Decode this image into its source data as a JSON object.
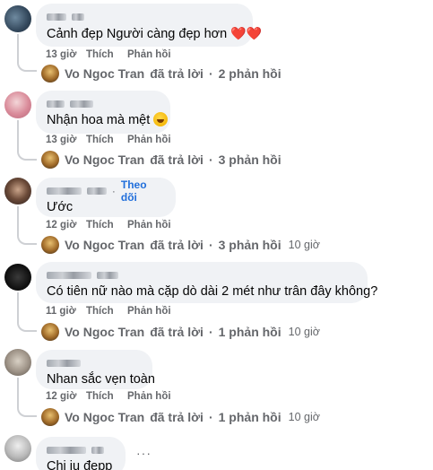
{
  "comments": [
    {
      "text": "Cảnh đẹp Người càng đẹp hơn",
      "emoji": "❤️❤️",
      "time": "13 giờ",
      "like": "Thích",
      "reply": "Phản hồi",
      "reply_summary": {
        "author": "Vo Ngoc Tran",
        "verb": "đã trả lời",
        "sep": "·",
        "count": "2 phản hồi",
        "time": ""
      }
    },
    {
      "text": "Nhận hoa mà mệt",
      "emoji": "laughing-face",
      "time": "13 giờ",
      "like": "Thích",
      "reply": "Phản hồi",
      "reply_summary": {
        "author": "Vo Ngoc Tran",
        "verb": "đã trả lời",
        "sep": "·",
        "count": "3 phản hồi",
        "time": ""
      }
    },
    {
      "text": "Ước",
      "follow": "Theo dõi",
      "follow_sep": "·",
      "time": "12 giờ",
      "like": "Thích",
      "reply": "Phản hồi",
      "reply_summary": {
        "author": "Vo Ngoc Tran",
        "verb": "đã trả lời",
        "sep": "·",
        "count": "3 phản hồi",
        "time": "10 giờ"
      }
    },
    {
      "text": "Có tiên nữ nào mà cặp dò dài 2 mét như trân đây không?",
      "time": "11 giờ",
      "like": "Thích",
      "reply": "Phản hồi",
      "reply_summary": {
        "author": "Vo Ngoc Tran",
        "verb": "đã trả lời",
        "sep": "·",
        "count": "1 phản hồi",
        "time": "10 giờ"
      }
    },
    {
      "text": "Nhan sắc vẹn toàn",
      "time": "12 giờ",
      "like": "Thích",
      "reply": "Phản hồi",
      "reply_summary": {
        "author": "Vo Ngoc Tran",
        "verb": "đã trả lời",
        "sep": "·",
        "count": "1 phản hồi",
        "time": "10 giờ"
      }
    },
    {
      "text": "Chị iu đẹpp",
      "more": "···"
    }
  ],
  "colors": {
    "bubble": "#f0f2f5",
    "link": "#216fdb",
    "meta": "#65676b",
    "heart": "#e0245e"
  }
}
